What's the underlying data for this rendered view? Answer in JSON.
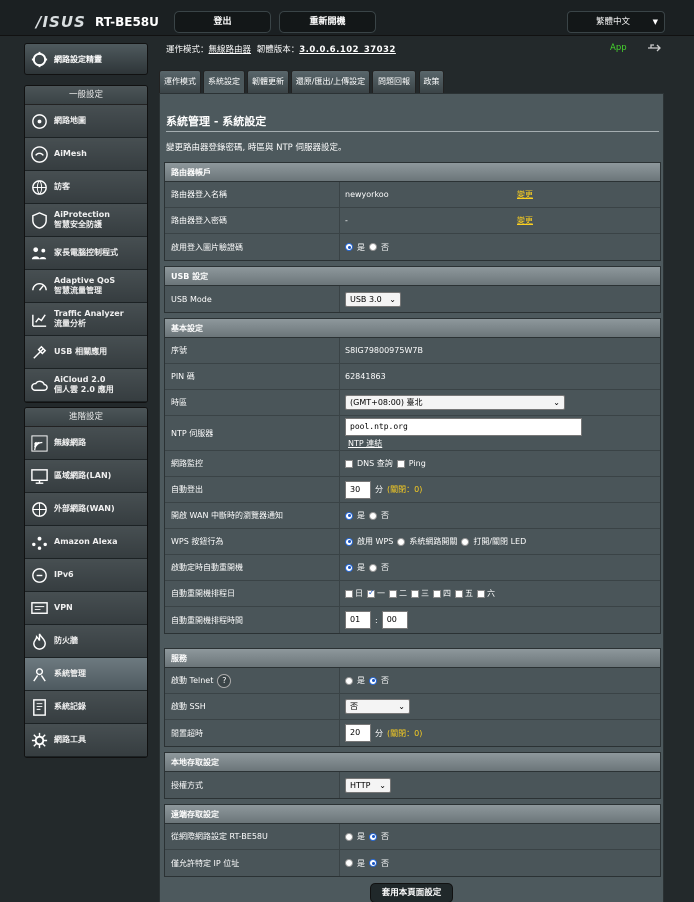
{
  "header": {
    "brand": "/ISUS",
    "model": "RT-BE58U",
    "logout": "登出",
    "reboot": "重新開機",
    "language": "繁體中文"
  },
  "status": {
    "mode_label": "運作模式：",
    "mode_value": "無線路由器",
    "fw_label": "韌體版本：",
    "fw_value": "3.0.0.6.102_37032",
    "app": "App"
  },
  "sidebar": {
    "qis": "網路設定精靈",
    "general_head": "一般設定",
    "general": [
      {
        "icon": "network-map-icon",
        "l1": "網路地圖",
        "l2": ""
      },
      {
        "icon": "aimesh-icon",
        "l1": "AiMesh",
        "l2": ""
      },
      {
        "icon": "globe-icon",
        "l1": "訪客",
        "l2": ""
      },
      {
        "icon": "shield-icon",
        "l1": "AiProtection",
        "l2": "智慧安全防護"
      },
      {
        "icon": "family-icon",
        "l1": "家長電腦控制程式",
        "l2": ""
      },
      {
        "icon": "qos-icon",
        "l1": "Adaptive QoS",
        "l2": "智慧流量管理"
      },
      {
        "icon": "analyzer-icon",
        "l1": "Traffic Analyzer",
        "l2": "流量分析"
      },
      {
        "icon": "usb-icon",
        "l1": "USB 相關應用",
        "l2": ""
      },
      {
        "icon": "cloud-icon",
        "l1": "AiCloud 2.0",
        "l2": "個人雲 2.0 應用"
      }
    ],
    "advanced_head": "進階設定",
    "advanced": [
      {
        "icon": "wireless-icon",
        "l1": "無線網路"
      },
      {
        "icon": "lan-icon",
        "l1": "區域網路(LAN)"
      },
      {
        "icon": "wan-icon",
        "l1": "外部網路(WAN)"
      },
      {
        "icon": "alexa-icon",
        "l1": "Amazon Alexa"
      },
      {
        "icon": "ipv6-icon",
        "l1": "IPv6"
      },
      {
        "icon": "vpn-icon",
        "l1": "VPN"
      },
      {
        "icon": "firewall-icon",
        "l1": "防火牆"
      },
      {
        "icon": "admin-icon",
        "l1": "系統管理"
      },
      {
        "icon": "log-icon",
        "l1": "系統記錄"
      },
      {
        "icon": "tools-icon",
        "l1": "網路工具"
      }
    ]
  },
  "tabs": [
    "運作模式",
    "系統設定",
    "韌體更新",
    "還原/匯出/上傳設定",
    "問題回報",
    "政策"
  ],
  "page": {
    "title": "系統管理 - 系統設定",
    "desc": "變更路由器登錄密碼, 時區與 NTP 伺服器設定。"
  },
  "router_login": {
    "head": "路由器帳戶",
    "name_label": "路由器登入名稱",
    "name_value": "newyorkoo",
    "change": "變更",
    "pwd_label": "路由器登入密碼",
    "pwd_value": "-",
    "captcha_label": "啟用登入圖片驗證碼",
    "yes": "是",
    "no": "否"
  },
  "usb": {
    "head": "USB 設定",
    "mode_label": "USB Mode",
    "mode_value": "USB 3.0"
  },
  "basic": {
    "head": "基本設定",
    "serial_label": "序號",
    "serial_value": "S8IG79800975W7B",
    "pin_label": "PIN 碼",
    "pin_value": "62841863",
    "tz_label": "時區",
    "tz_value": "(GMT+08:00) 臺北",
    "ntp_label": "NTP 伺服器",
    "ntp_value": "pool.ntp.org",
    "ntp_link": "NTP 連結",
    "monitor_label": "網路監控",
    "dns_query": "DNS 查詢",
    "ping": "Ping",
    "logout_label": "自動登出",
    "logout_value": "30",
    "logout_unit": "分",
    "logout_hint": "(關閉：0)",
    "wan_notify_label": "開啟 WAN 中斷時的瀏覽器通知",
    "wps_label": "WPS 按鈕行為",
    "wps_opt1": "啟用 WPS",
    "wps_opt2": "系統網路開關",
    "wps_opt3": "打開/關閉 LED",
    "reboot_sched_label": "啟動定時自動重開機",
    "reboot_days_label": "自動重開機排程日",
    "days": [
      "日",
      "一",
      "二",
      "三",
      "四",
      "五",
      "六"
    ],
    "reboot_time_label": "自動重開機排程時間",
    "hour": "01",
    "minute": "00"
  },
  "service": {
    "head": "服務",
    "telnet_label": "啟動 Telnet",
    "ssh_label": "啟動 SSH",
    "ssh_value": "否",
    "idle_label": "閒置超時",
    "idle_value": "20",
    "idle_unit": "分",
    "idle_hint": "(關閉：0)"
  },
  "local_access": {
    "head": "本地存取設定",
    "auth_label": "授權方式",
    "auth_value": "HTTP"
  },
  "remote_access": {
    "head": "遠端存取設定",
    "wan_label": "從網際網路設定 RT-BE58U",
    "ip_label": "僅允許特定 IP 位址"
  },
  "apply": "套用本頁面設定",
  "colors": {
    "accent_yellow": "#fcd020",
    "app_green": "#46d52d"
  }
}
